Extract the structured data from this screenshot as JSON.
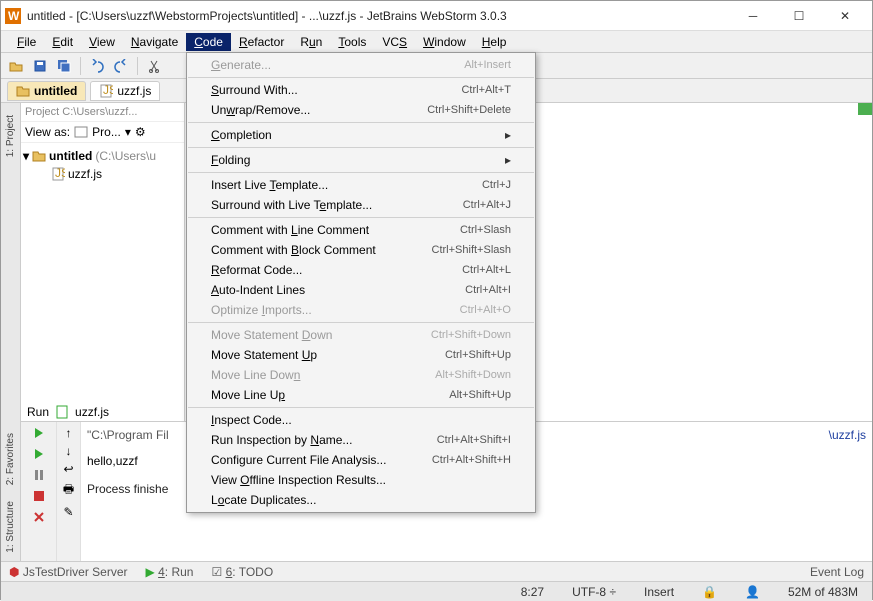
{
  "window": {
    "title": "untitled - [C:\\Users\\uzzf\\WebstormProjects\\untitled] - ...\\uzzf.js - JetBrains WebStorm 3.0.3"
  },
  "menubar": {
    "file": "File",
    "edit": "Edit",
    "view": "View",
    "navigate": "Navigate",
    "code": "Code",
    "refactor": "Refactor",
    "run": "Run",
    "tools": "Tools",
    "vcs": "VCS",
    "window": "Window",
    "help": "Help"
  },
  "breadcrumb": {
    "folder": "untitled",
    "file": "uzzf.js"
  },
  "project": {
    "header": "Project C:\\Users\\uzzf...",
    "viewAs": "View as:",
    "viewValue": "Pro...",
    "root": "untitled",
    "rootSuffix": "(C:\\Users\\u",
    "file": "uzzf.js"
  },
  "leftTabs": {
    "project": "1: Project",
    "favorites": "2: Favorites",
    "structure": "1: Structure"
  },
  "editor": {
    "commentEnd": ".*/"
  },
  "codeMenu": {
    "generate": "Generate...",
    "surroundWith": "Surround With...",
    "unwrap": "Unwrap/Remove...",
    "completion": "Completion",
    "folding": "Folding",
    "insertLive": "Insert Live Template...",
    "surroundLive": "Surround with Live Template...",
    "commentLine": "Comment with Line Comment",
    "commentBlock": "Comment with Block Comment",
    "reformat": "Reformat Code...",
    "autoIndent": "Auto-Indent Lines",
    "optimize": "Optimize Imports...",
    "moveStDown": "Move Statement Down",
    "moveStUp": "Move Statement Up",
    "moveLnDown": "Move Line Down",
    "moveLnUp": "Move Line Up",
    "inspect": "Inspect Code...",
    "runInsp": "Run Inspection by Name...",
    "configAnalysis": "Configure Current File Analysis...",
    "viewOffline": "View Offline Inspection Results...",
    "locateDup": "Locate Duplicates...",
    "sc": {
      "generate": "Alt+Insert",
      "surroundWith": "Ctrl+Alt+T",
      "unwrap": "Ctrl+Shift+Delete",
      "insertLive": "Ctrl+J",
      "surroundLive": "Ctrl+Alt+J",
      "commentLine": "Ctrl+Slash",
      "commentBlock": "Ctrl+Shift+Slash",
      "reformat": "Ctrl+Alt+L",
      "autoIndent": "Ctrl+Alt+I",
      "optimize": "Ctrl+Alt+O",
      "moveStDown": "Ctrl+Shift+Down",
      "moveStUp": "Ctrl+Shift+Up",
      "moveLnDown": "Alt+Shift+Down",
      "moveLnUp": "Alt+Shift+Up",
      "runInsp": "Ctrl+Alt+Shift+I",
      "configAnalysis": "Ctrl+Alt+Shift+H"
    }
  },
  "run": {
    "header": "Run",
    "config": "uzzf.js",
    "path": "\"C:\\Program Fil",
    "fileRef": "\\uzzf.js",
    "output": "hello,uzzf",
    "status": "Process finishe"
  },
  "bottom": {
    "jstest": "JsTestDriver Server",
    "runTab": "4: Run",
    "todo": "6: TODO",
    "eventLog": "Event Log"
  },
  "status": {
    "pos": "8:27",
    "encoding": "UTF-8",
    "insert": "Insert",
    "mem": "52M of 483M"
  }
}
